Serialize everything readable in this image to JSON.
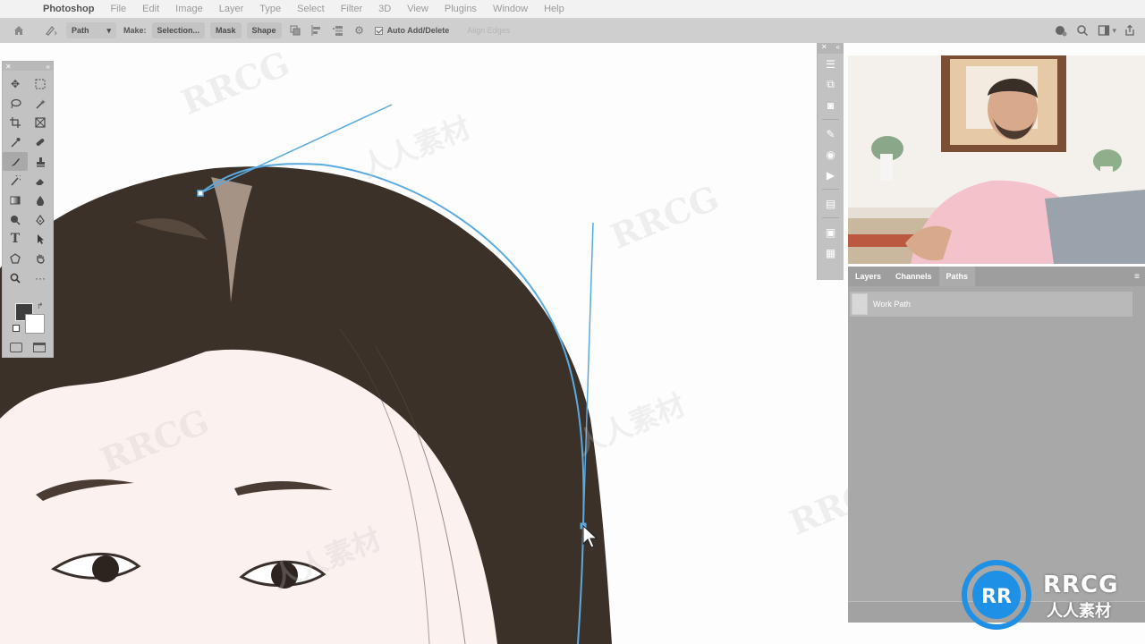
{
  "menubar": {
    "app": "Photoshop",
    "items": [
      "File",
      "Edit",
      "Image",
      "Layer",
      "Type",
      "Select",
      "Filter",
      "3D",
      "View",
      "Plugins",
      "Window",
      "Help"
    ]
  },
  "options": {
    "mode": "Path",
    "make_label": "Make:",
    "selection": "Selection...",
    "mask": "Mask",
    "shape": "Shape",
    "auto_add_delete": "Auto Add/Delete",
    "align_edges": "Align Edges"
  },
  "paths_panel": {
    "tabs": [
      "Layers",
      "Channels",
      "Paths"
    ],
    "active_tab": "Paths",
    "rows": [
      "Work Path"
    ]
  },
  "watermark": {
    "text": "RRCG",
    "text_cn": "人人素材",
    "logo_text": "RRCG",
    "logo_cn": "人人素材"
  },
  "colors": {
    "path": "#5aaae0",
    "accent": "#1e90e6",
    "hair": "#3b3129",
    "skin": "#fbf1ee",
    "foreground": "#3d3d3d",
    "background": "#ffffff"
  }
}
